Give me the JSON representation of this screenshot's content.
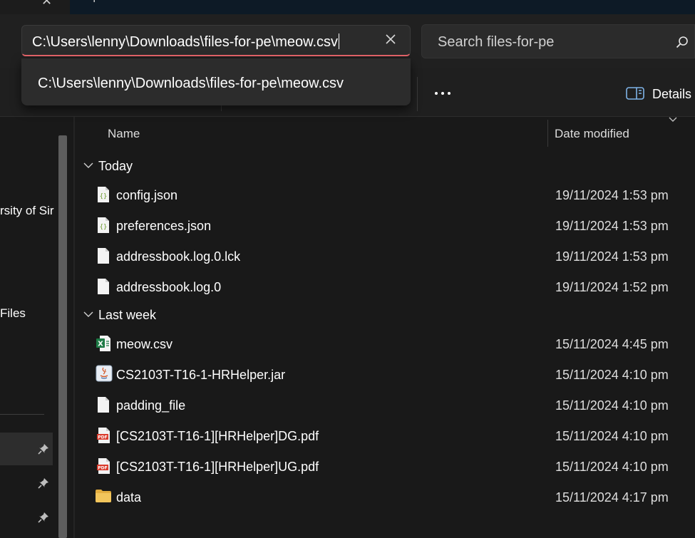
{
  "window": {
    "tab_title_remnant": "ı"
  },
  "address_bar": {
    "path": "C:\\Users\\lenny\\Downloads\\files-for-pe\\meow.csv"
  },
  "suggestions": [
    "C:\\Users\\lenny\\Downloads\\files-for-pe\\meow.csv"
  ],
  "search": {
    "placeholder": "Search files-for-pe"
  },
  "command_bar": {
    "details_label": "Details"
  },
  "nav": {
    "item_partial_1": "rsity of Sir",
    "item_partial_2": "Files"
  },
  "columns": {
    "name": "Name",
    "date_modified": "Date modified"
  },
  "groups": [
    {
      "label": "Today",
      "files": [
        {
          "name": "config.json",
          "date": "19/11/2024 1:53 pm",
          "icon": "json-file-icon"
        },
        {
          "name": "preferences.json",
          "date": "19/11/2024 1:53 pm",
          "icon": "json-file-icon"
        },
        {
          "name": "addressbook.log.0.lck",
          "date": "19/11/2024 1:53 pm",
          "icon": "blank-file-icon"
        },
        {
          "name": "addressbook.log.0",
          "date": "19/11/2024 1:52 pm",
          "icon": "blank-file-icon"
        }
      ]
    },
    {
      "label": "Last week",
      "files": [
        {
          "name": "meow.csv",
          "date": "15/11/2024 4:45 pm",
          "icon": "excel-csv-icon"
        },
        {
          "name": "CS2103T-T16-1-HRHelper.jar",
          "date": "15/11/2024 4:10 pm",
          "icon": "java-jar-icon"
        },
        {
          "name": "padding_file",
          "date": "15/11/2024 4:10 pm",
          "icon": "blank-file-icon"
        },
        {
          "name": "[CS2103T-T16-1][HRHelper]DG.pdf",
          "date": "15/11/2024 4:10 pm",
          "icon": "pdf-file-icon"
        },
        {
          "name": "[CS2103T-T16-1][HRHelper]UG.pdf",
          "date": "15/11/2024 4:10 pm",
          "icon": "pdf-file-icon"
        },
        {
          "name": "data",
          "date": "15/11/2024 4:17 pm",
          "icon": "folder-icon"
        }
      ]
    }
  ],
  "colors": {
    "address_underline": "#e8656b",
    "folder": "#f2c55c",
    "excel_green": "#1d7a45",
    "pdf_red": "#d93a2b"
  }
}
